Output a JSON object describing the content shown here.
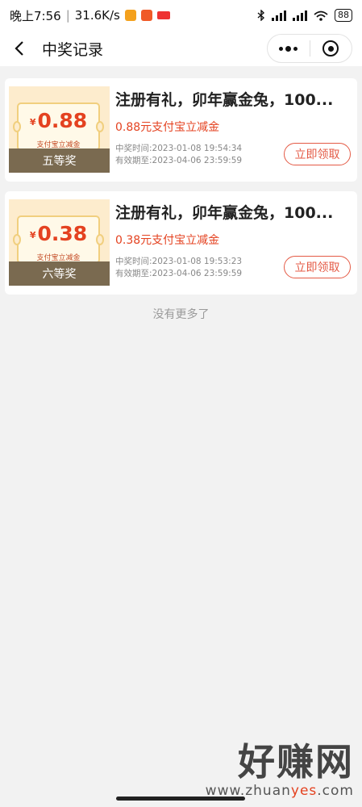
{
  "statusbar": {
    "time": "晚上7:56",
    "speed": "31.6K/s",
    "battery": "88",
    "icons": [
      "bluetooth-icon",
      "signal-icon",
      "signal-icon",
      "wifi-icon"
    ]
  },
  "navbar": {
    "title": "中奖记录",
    "back_icon": "chevron-left-icon",
    "menu_icon": "more-dots-icon",
    "close_icon": "target-icon"
  },
  "records": [
    {
      "amount": "0.88",
      "currency": "¥",
      "coupon_label": "支付宝立减金",
      "level": "五等奖",
      "title": "注册有礼，卯年赢金兔，100...",
      "desc": "0.88元支付宝立减金",
      "win_time": "中奖时间:2023-01-08 19:54:34",
      "valid_until": "有效期至:2023-04-06 23:59:59",
      "button": "立即领取"
    },
    {
      "amount": "0.38",
      "currency": "¥",
      "coupon_label": "支付宝立减金",
      "level": "六等奖",
      "title": "注册有礼，卯年赢金兔，100...",
      "desc": "0.38元支付宝立减金",
      "win_time": "中奖时间:2023-01-08 19:53:23",
      "valid_until": "有效期至:2023-04-06 23:59:59",
      "button": "立即领取"
    }
  ],
  "footer": {
    "no_more": "没有更多了"
  },
  "watermark": {
    "big": "好赚网",
    "small_prefix": "www.zhuan",
    "small_accent": "yes",
    "small_suffix": ".com"
  },
  "colors": {
    "accent": "#e44220",
    "button": "#e45a45",
    "level_bar": "#7a6a50",
    "thumb_bg": "#fdeccd"
  }
}
